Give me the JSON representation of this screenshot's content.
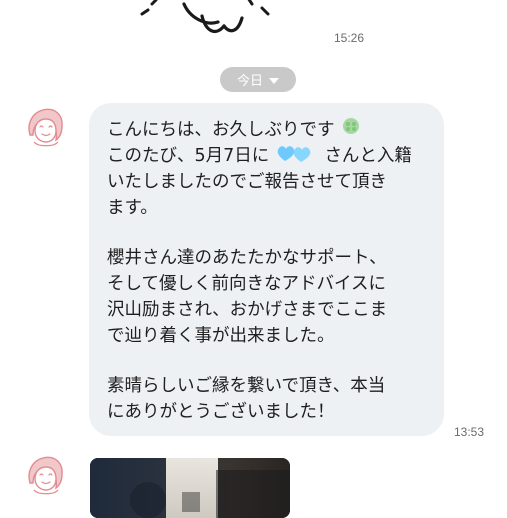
{
  "chat": {
    "messages": [
      {
        "time": "15:26"
      },
      {
        "time": "13:53",
        "lines": [
          "こんにちは、お久しぶりです",
          "このたび、5月7日に",
          "さんと入籍",
          "いたしましたのでご報告させて頂き",
          "ます。",
          "櫻井さん達のあたたかなサポート、",
          "そして優しく前向きなアドバイスに",
          "沢山励まされ、おかげさまでここま",
          "で辿り着く事が出来ました。",
          "素晴らしいご縁を繋いで頂き、本当",
          "にありがとうございました！"
        ]
      }
    ],
    "date_separator": "今日"
  }
}
